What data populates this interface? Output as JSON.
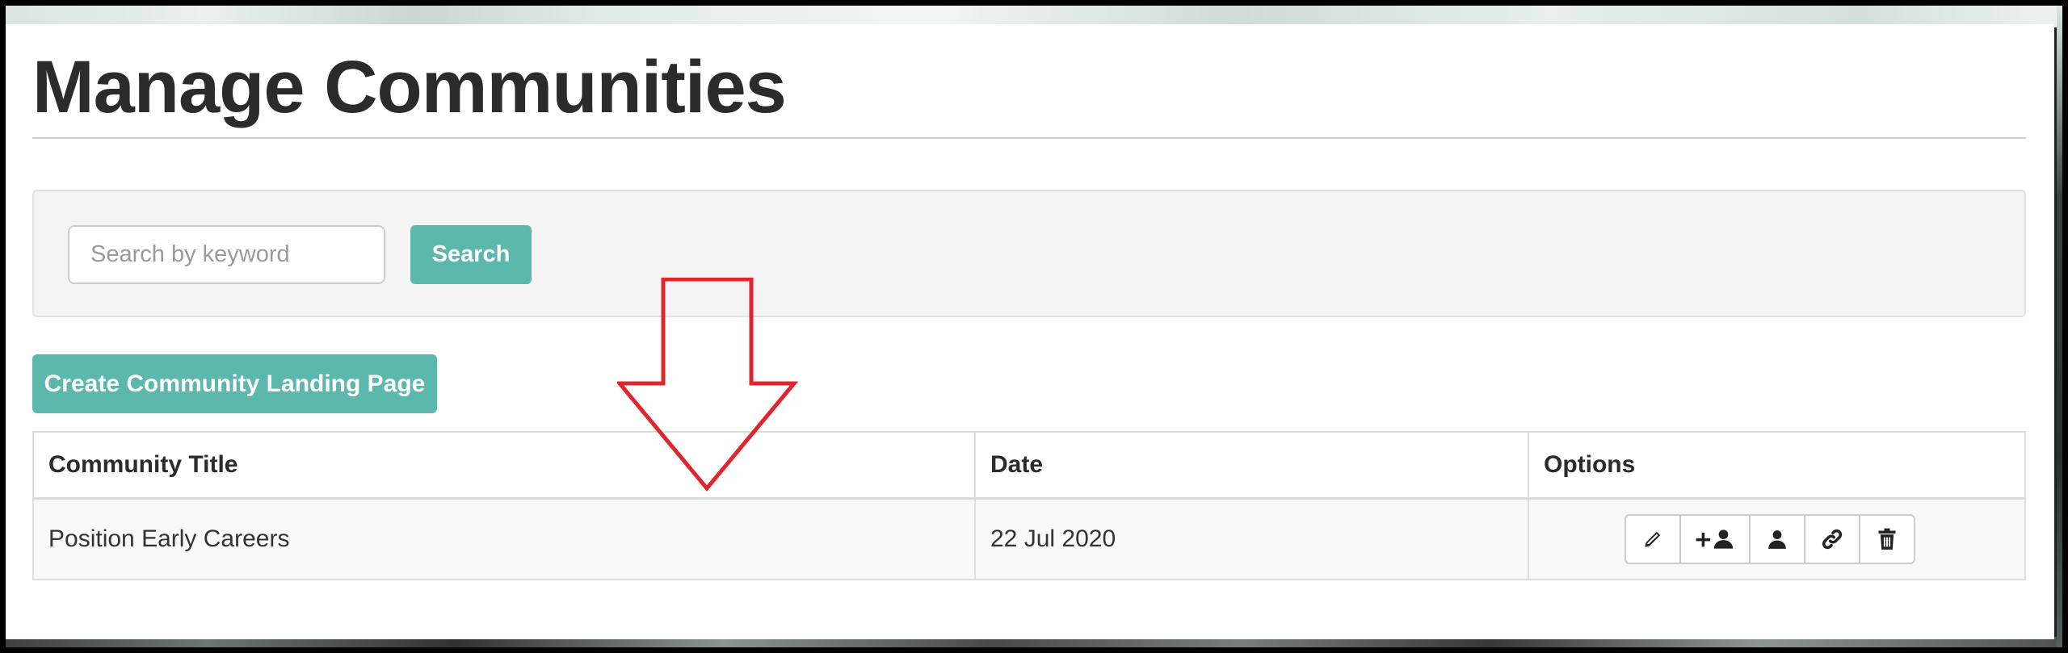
{
  "page": {
    "title": "Manage Communities"
  },
  "search": {
    "placeholder": "Search by keyword",
    "value": "",
    "button_label": "Search"
  },
  "actions": {
    "create_label": "Create Community Landing Page"
  },
  "table": {
    "headers": {
      "title": "Community Title",
      "date": "Date",
      "options": "Options"
    },
    "rows": [
      {
        "title": "Position Early Careers",
        "date": "22 Jul 2020",
        "options": [
          "pencil-icon",
          "add-user-icon",
          "user-icon",
          "link-icon",
          "trash-icon"
        ]
      }
    ]
  },
  "colors": {
    "accent": "#5cb8ac",
    "title_text": "#2b2b2b",
    "annotation_arrow": "#e0262d"
  }
}
